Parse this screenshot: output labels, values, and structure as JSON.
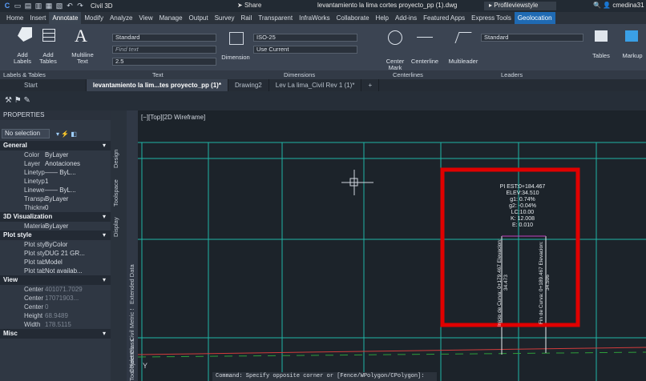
{
  "titlebar": {
    "app": "Civil 3D",
    "share": "Share",
    "filename": "levantamiento la lima cortes proyecto_pp (1).dwg",
    "workspace": "Profileviewstyle",
    "user": "cmedina31"
  },
  "menu": [
    "Home",
    "Insert",
    "Annotate",
    "Modify",
    "Analyze",
    "View",
    "Manage",
    "Output",
    "Survey",
    "Rail",
    "Transparent",
    "InfraWorks",
    "Collaborate",
    "Help",
    "Add-ins",
    "Featured Apps",
    "Express Tools",
    "Geolocation"
  ],
  "ribbon": {
    "add_labels": "Add Labels",
    "add_tables": "Add Tables",
    "multiline_text": "Multiline Text",
    "text_style": "Standard",
    "find_text": "Find text",
    "text_height": "2.5",
    "dimension": "Dimension",
    "dim_style": "ISO-25",
    "use_current": "Use Current",
    "center_mark": "Center Mark",
    "centerline": "Centerline",
    "multileader": "Multileader",
    "leader_style": "Standard",
    "tables": "Tables",
    "markup": "Markup",
    "panels": {
      "labels": "Labels & Tables",
      "text": "Text",
      "dimensions": "Dimensions",
      "centerlines": "Centerlines",
      "leaders": "Leaders"
    }
  },
  "doctabs": [
    "Start",
    "levantamiento la lim...tes proyecto_pp (1)*",
    "Drawing2",
    "Lev La lima_Civil Rev 1 (1)*"
  ],
  "viewport_label": "[−][Top][2D Wireframe]",
  "properties": {
    "title": "PROPERTIES",
    "selection": "No selection",
    "sections": [
      {
        "name": "General",
        "rows": [
          [
            "Color",
            "ByLayer"
          ],
          [
            "Layer",
            "Anotaciones"
          ],
          [
            "Linetype",
            "—— ByL..."
          ],
          [
            "Linetype sc...",
            "1"
          ],
          [
            "Lineweight",
            "—— ByL..."
          ],
          [
            "Transparency",
            "ByLayer"
          ],
          [
            "Thickness",
            "0"
          ]
        ]
      },
      {
        "name": "3D Visualization",
        "rows": [
          [
            "Material",
            "ByLayer"
          ]
        ]
      },
      {
        "name": "Plot style",
        "rows": [
          [
            "Plot style",
            "ByColor"
          ],
          [
            "Plot style ta...",
            "DUG 21 GR..."
          ],
          [
            "Plot table a...",
            "Model"
          ],
          [
            "Plot table ty...",
            "Not availab..."
          ]
        ]
      },
      {
        "name": "View",
        "rows": [
          [
            "Center X",
            "401071.7029"
          ],
          [
            "Center Y",
            "1707190​3..."
          ],
          [
            "Center Z",
            "0"
          ],
          [
            "Height",
            "68.9489"
          ],
          [
            "Width",
            "178.5115"
          ]
        ]
      },
      {
        "name": "Misc",
        "rows": []
      }
    ]
  },
  "side_tabs": [
    "Design",
    "Toolspace",
    "Display",
    "Extended Data",
    "Tool Palettes - Civil Metric Subassemblies",
    "Object Class"
  ],
  "curve_label": [
    "PI EST:0+184.467",
    "ELEV:34.510",
    "g1: 0.74%",
    "g2: -0.04%",
    "LC:10.00",
    "K: 12.008",
    "E: 0.010"
  ],
  "curve_start": [
    "Inicio de Curva: 0+179.467",
    "Elevacion: 34.473"
  ],
  "curve_end": [
    "Fin de Curva: 0+189.467",
    "Elevacion: 34.506"
  ],
  "command_line": "Command: Specify opposite corner or [Fence/WPolygon/CPolygon]:",
  "colors": {
    "highlight": "#e00000",
    "grid": "#1fb5a6"
  }
}
